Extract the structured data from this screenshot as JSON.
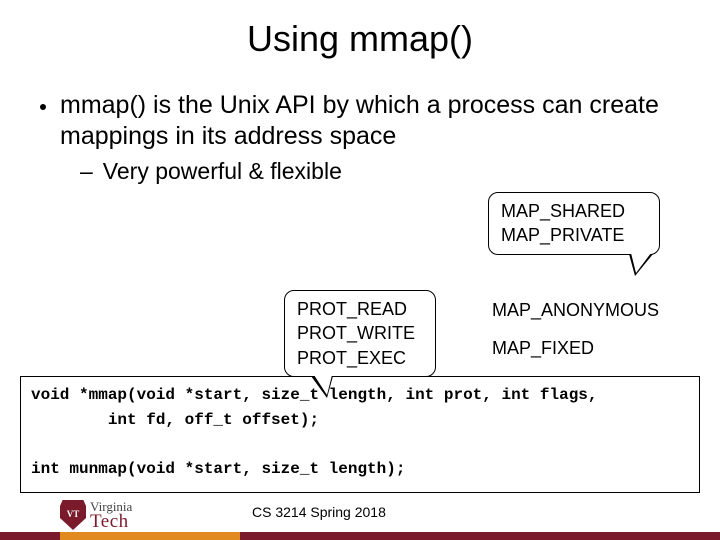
{
  "title": "Using mmap()",
  "bullet_main": "mmap() is the Unix API by which a process can create mappings in its address space",
  "bullet_sub_dash": "–",
  "bullet_sub": "Very powerful & flexible",
  "callout_flags": {
    "line1": "MAP_SHARED",
    "line2": "MAP_PRIVATE"
  },
  "callout_prot": {
    "line1": "PROT_READ",
    "line2": "PROT_WRITE",
    "line3": "PROT_EXEC"
  },
  "annot_anon": "MAP_ANONYMOUS",
  "annot_fixed": "MAP_FIXED",
  "code": "void *mmap(void *start, size_t length, int prot, int flags,\n        int fd, off_t offset);\n\nint munmap(void *start, size_t length);",
  "logo": {
    "top": "Virginia",
    "bottom": "Tech"
  },
  "footer_course": "CS 3214 Spring 2018"
}
